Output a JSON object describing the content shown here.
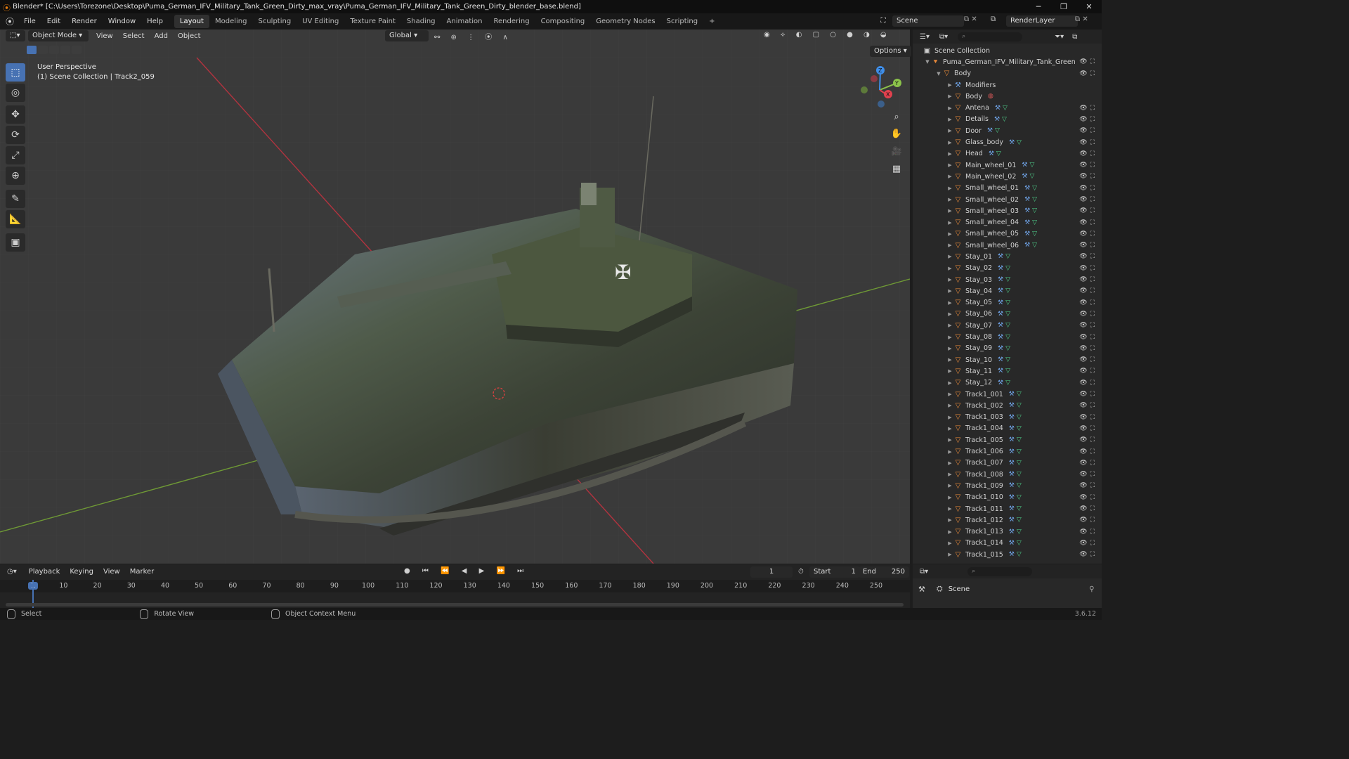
{
  "window": {
    "title": "Blender* [C:\\Users\\Torezone\\Desktop\\Puma_German_IFV_Military_Tank_Green_Dirty_max_vray\\Puma_German_IFV_Military_Tank_Green_Dirty_blender_base.blend]",
    "controls": [
      "─",
      "❐",
      "✕"
    ]
  },
  "menu": [
    "File",
    "Edit",
    "Render",
    "Window",
    "Help"
  ],
  "workspaces": [
    {
      "label": "Layout",
      "active": true
    },
    {
      "label": "Modeling"
    },
    {
      "label": "Sculpting"
    },
    {
      "label": "UV Editing"
    },
    {
      "label": "Texture Paint"
    },
    {
      "label": "Shading"
    },
    {
      "label": "Animation"
    },
    {
      "label": "Rendering"
    },
    {
      "label": "Compositing"
    },
    {
      "label": "Geometry Nodes"
    },
    {
      "label": "Scripting"
    }
  ],
  "add_workspace": "+",
  "scene_name": "Scene",
  "view_layer": "RenderLayer",
  "viewport": {
    "mode": "Object Mode",
    "menus": [
      "View",
      "Select",
      "Add",
      "Object"
    ],
    "transform_orientation": "Global",
    "options_label": "Options",
    "overlay_title": "User Perspective",
    "overlay_subtitle": "(1) Scene Collection | Track2_059",
    "gizmo_axes": [
      "X",
      "Y",
      "Z"
    ],
    "decal": "✠"
  },
  "toolbar_icons": [
    "select-box-icon",
    "cursor-icon",
    "move-icon",
    "rotate-icon",
    "scale-icon",
    "transform-icon",
    "annotate-icon",
    "measure-icon",
    "add-cube-icon"
  ],
  "toolbar_glyphs": [
    "⬚",
    "◎",
    "✥",
    "⟳",
    "⤢",
    "⊕",
    "✎",
    "📐",
    "▣"
  ],
  "nav_glyphs": [
    "⌕",
    "✋",
    "🎥",
    "▦"
  ],
  "outliner": {
    "root": "Scene Collection",
    "collection": "Puma_German_IFV_Military_Tank_Green",
    "body": "Body",
    "modifiers": "Modifiers",
    "items": [
      "Body",
      "Antena",
      "Details",
      "Door",
      "Glass_body",
      "Head",
      "Main_wheel_01",
      "Main_wheel_02",
      "Small_wheel_01",
      "Small_wheel_02",
      "Small_wheel_03",
      "Small_wheel_04",
      "Small_wheel_05",
      "Small_wheel_06",
      "Stay_01",
      "Stay_02",
      "Stay_03",
      "Stay_04",
      "Stay_05",
      "Stay_06",
      "Stay_07",
      "Stay_08",
      "Stay_09",
      "Stay_10",
      "Stay_11",
      "Stay_12",
      "Track1_001",
      "Track1_002",
      "Track1_003",
      "Track1_004",
      "Track1_005",
      "Track1_006",
      "Track1_007",
      "Track1_008",
      "Track1_009",
      "Track1_010",
      "Track1_011",
      "Track1_012",
      "Track1_013",
      "Track1_014",
      "Track1_015"
    ]
  },
  "timeline": {
    "menus": [
      "Playback",
      "Keying",
      "View",
      "Marker"
    ],
    "current_frame": "1",
    "start_label": "Start",
    "start": "1",
    "end_label": "End",
    "end": "250",
    "ticks": [
      "1",
      "10",
      "20",
      "30",
      "40",
      "50",
      "60",
      "70",
      "80",
      "90",
      "100",
      "110",
      "120",
      "130",
      "140",
      "150",
      "160",
      "170",
      "180",
      "190",
      "200",
      "210",
      "220",
      "230",
      "240",
      "250"
    ]
  },
  "properties": {
    "scene": "Scene"
  },
  "status": {
    "items": [
      "Select",
      "Rotate View",
      "Object Context Menu"
    ],
    "version": "3.6.12"
  },
  "colors": {
    "accent": "#4772b3",
    "x_axis": "#e2414e",
    "y_axis": "#8bc34a",
    "z_axis": "#3f8ee8",
    "object_icon": "#e98a3a"
  }
}
